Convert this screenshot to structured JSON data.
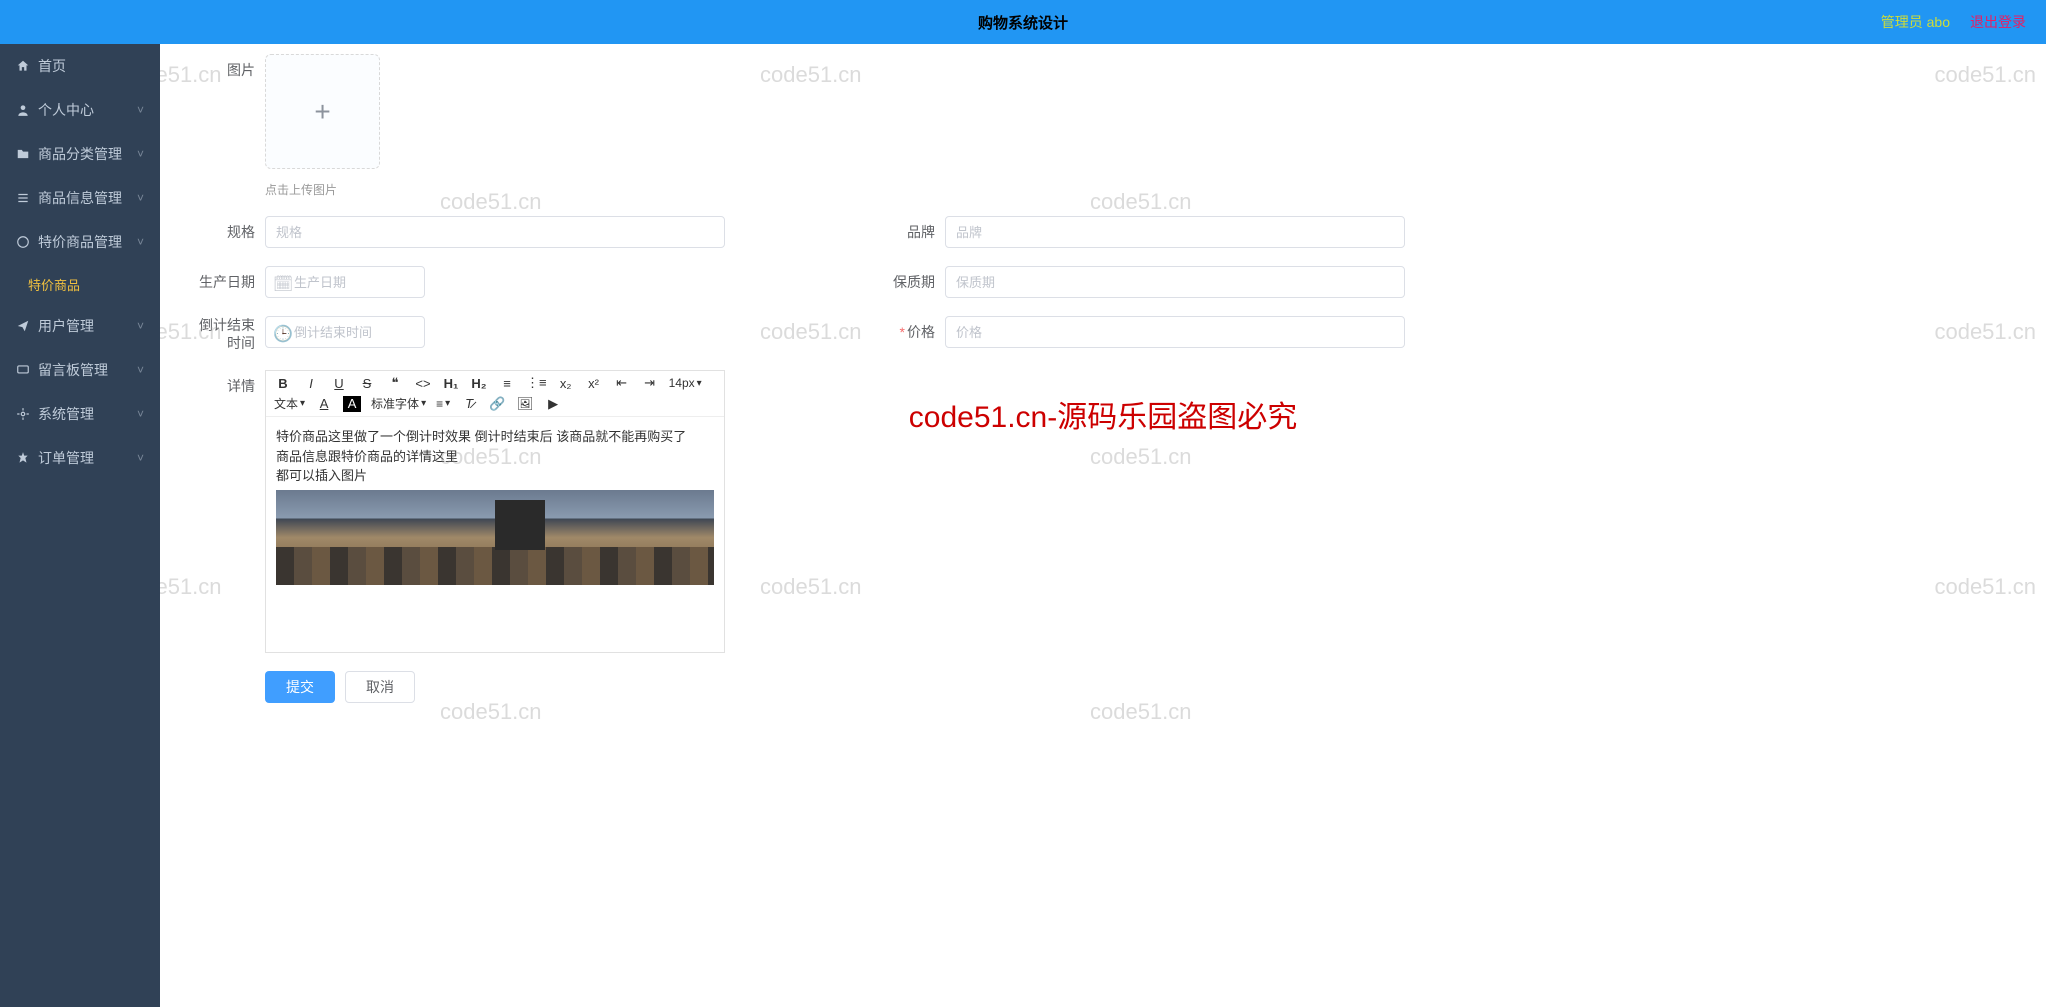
{
  "header": {
    "title": "购物系统设计",
    "admin": "管理员 abo",
    "logout": "退出登录"
  },
  "sidebar": {
    "items": [
      {
        "label": "首页",
        "icon": "home"
      },
      {
        "label": "个人中心",
        "icon": "user"
      },
      {
        "label": "商品分类管理",
        "icon": "folder"
      },
      {
        "label": "商品信息管理",
        "icon": "list"
      },
      {
        "label": "特价商品管理",
        "icon": "tag"
      },
      {
        "label": "特价商品",
        "sub": true
      },
      {
        "label": "用户管理",
        "icon": "send"
      },
      {
        "label": "留言板管理",
        "icon": "message"
      },
      {
        "label": "系统管理",
        "icon": "gear"
      },
      {
        "label": "订单管理",
        "icon": "cart"
      }
    ]
  },
  "form": {
    "image_label": "图片",
    "upload_hint": "点击上传图片",
    "spec_label": "规格",
    "spec_placeholder": "规格",
    "brand_label": "品牌",
    "brand_placeholder": "品牌",
    "prod_date_label": "生产日期",
    "prod_date_placeholder": "生产日期",
    "shelf_label": "保质期",
    "shelf_placeholder": "保质期",
    "countdown_label": "倒计结束时间",
    "countdown_placeholder": "倒计结束时间",
    "price_label": "价格",
    "price_placeholder": "价格",
    "detail_label": "详情"
  },
  "editor": {
    "font_size": "14px",
    "font_type": "文本",
    "font_family": "标准字体",
    "content_line1": "特价商品这里做了一个倒计时效果  倒计时结束后  该商品就不能再购买了",
    "content_line2": "商品信息跟特价商品的详情这里",
    "content_line3": "都可以插入图片"
  },
  "actions": {
    "submit": "提交",
    "cancel": "取消"
  },
  "watermark": {
    "text": "code51.cn",
    "red": "code51.cn-源码乐园盗图必究"
  }
}
